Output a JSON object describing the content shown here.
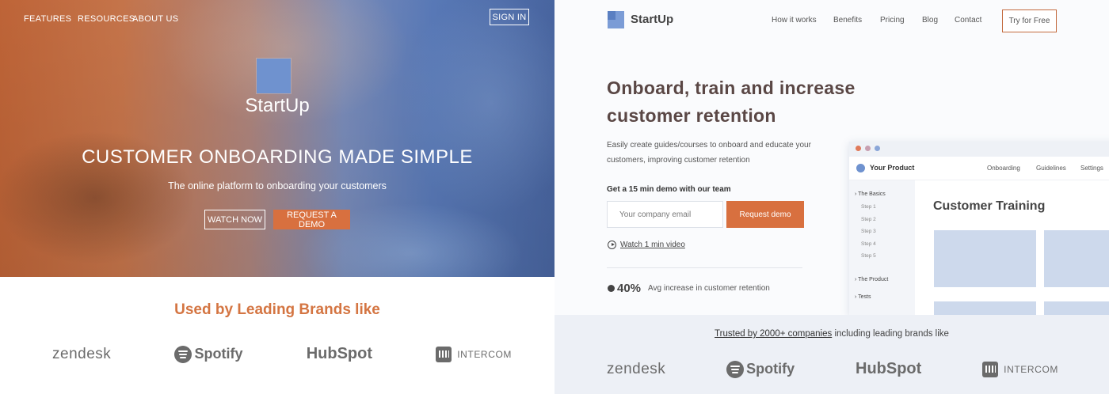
{
  "left": {
    "nav": {
      "features": "FEATURES",
      "resources": "RESOURCES",
      "about": "ABOUT US",
      "signin": "SIGN IN"
    },
    "hero": {
      "brand": "StartUp",
      "headline": "CUSTOMER ONBOARDING MADE SIMPLE",
      "subtitle": "The online platform to onboarding your customers",
      "watch_label": "WATCH NOW",
      "demo_label": "REQUEST A DEMO"
    },
    "brands_title": "Used by Leading Brands like",
    "brands": [
      "zendesk",
      "Spotify",
      "HubSpot",
      "INTERCOM"
    ]
  },
  "right": {
    "brand": "StartUp",
    "nav": {
      "how": "How it works",
      "benefits": "Benefits",
      "pricing": "Pricing",
      "blog": "Blog",
      "contact": "Contact"
    },
    "try_label": "Try for Free",
    "headline": "Onboard, train and increase customer retention",
    "description": "Easily create guides/courses to onboard and educate your customers, improving customer retention",
    "demo_label": "Get a 15 min demo with our team",
    "email_placeholder": "Your company email",
    "request_label": "Request demo",
    "watch_label": "Watch 1 min video",
    "stat": {
      "value": "40%",
      "label": "Avg increase in customer retention"
    },
    "preview": {
      "title": "Your Product",
      "nav": [
        "Onboarding",
        "Guidelines",
        "Settings"
      ],
      "sections": [
        "The Basics",
        "The Product",
        "Tests"
      ],
      "steps": [
        "Step 1",
        "Step 2",
        "Step 3",
        "Step 4",
        "Step 5"
      ],
      "heading": "Customer Training"
    },
    "trusted_link": "Trusted by 2000+ companies",
    "trusted_rest": " including leading brands like",
    "brands": [
      "zendesk",
      "Spotify",
      "HubSpot",
      "INTERCOM"
    ]
  },
  "colors": {
    "accent": "#d8703f",
    "brand_blue": "#6f92cf",
    "logo_gray": "#6b6b6b"
  }
}
